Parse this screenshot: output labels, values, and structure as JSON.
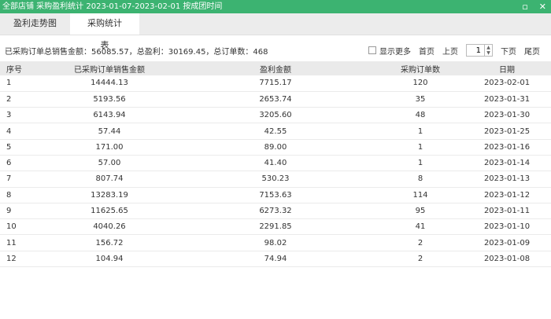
{
  "window": {
    "title": "全部店铺 采购盈利统计 2023-01-07-2023-02-01 按成团时间",
    "minimize_glyph": "▫",
    "close_glyph": "✕"
  },
  "tabs": [
    {
      "label": "盈利走势图",
      "active": false
    },
    {
      "label": "采购统计表",
      "active": true
    }
  ],
  "summary": "已采购订单总销售金额：56085.57，总盈利：30169.45，总订单数：468",
  "pager": {
    "show_more_label": "显示更多",
    "first_label": "首页",
    "prev_label": "上页",
    "page_value": "1",
    "next_label": "下页",
    "last_label": "尾页"
  },
  "table": {
    "headers": [
      "序号",
      "已采购订单销售金额",
      "盈利金额",
      "采购订单数",
      "日期"
    ],
    "rows": [
      [
        "1",
        "14444.13",
        "7715.17",
        "120",
        "2023-02-01"
      ],
      [
        "2",
        "5193.56",
        "2653.74",
        "35",
        "2023-01-31"
      ],
      [
        "3",
        "6143.94",
        "3205.60",
        "48",
        "2023-01-30"
      ],
      [
        "4",
        "57.44",
        "42.55",
        "1",
        "2023-01-25"
      ],
      [
        "5",
        "171.00",
        "89.00",
        "1",
        "2023-01-16"
      ],
      [
        "6",
        "57.00",
        "41.40",
        "1",
        "2023-01-14"
      ],
      [
        "7",
        "807.74",
        "530.23",
        "8",
        "2023-01-13"
      ],
      [
        "8",
        "13283.19",
        "7153.63",
        "114",
        "2023-01-12"
      ],
      [
        "9",
        "11625.65",
        "6273.32",
        "95",
        "2023-01-11"
      ],
      [
        "10",
        "4040.26",
        "2291.85",
        "41",
        "2023-01-10"
      ],
      [
        "11",
        "156.72",
        "98.02",
        "2",
        "2023-01-09"
      ],
      [
        "12",
        "104.94",
        "74.94",
        "2",
        "2023-01-08"
      ]
    ]
  },
  "colors": {
    "titlebar": "#3cb371",
    "tabbar": "#ececec",
    "header_row": "#eaeaea"
  }
}
